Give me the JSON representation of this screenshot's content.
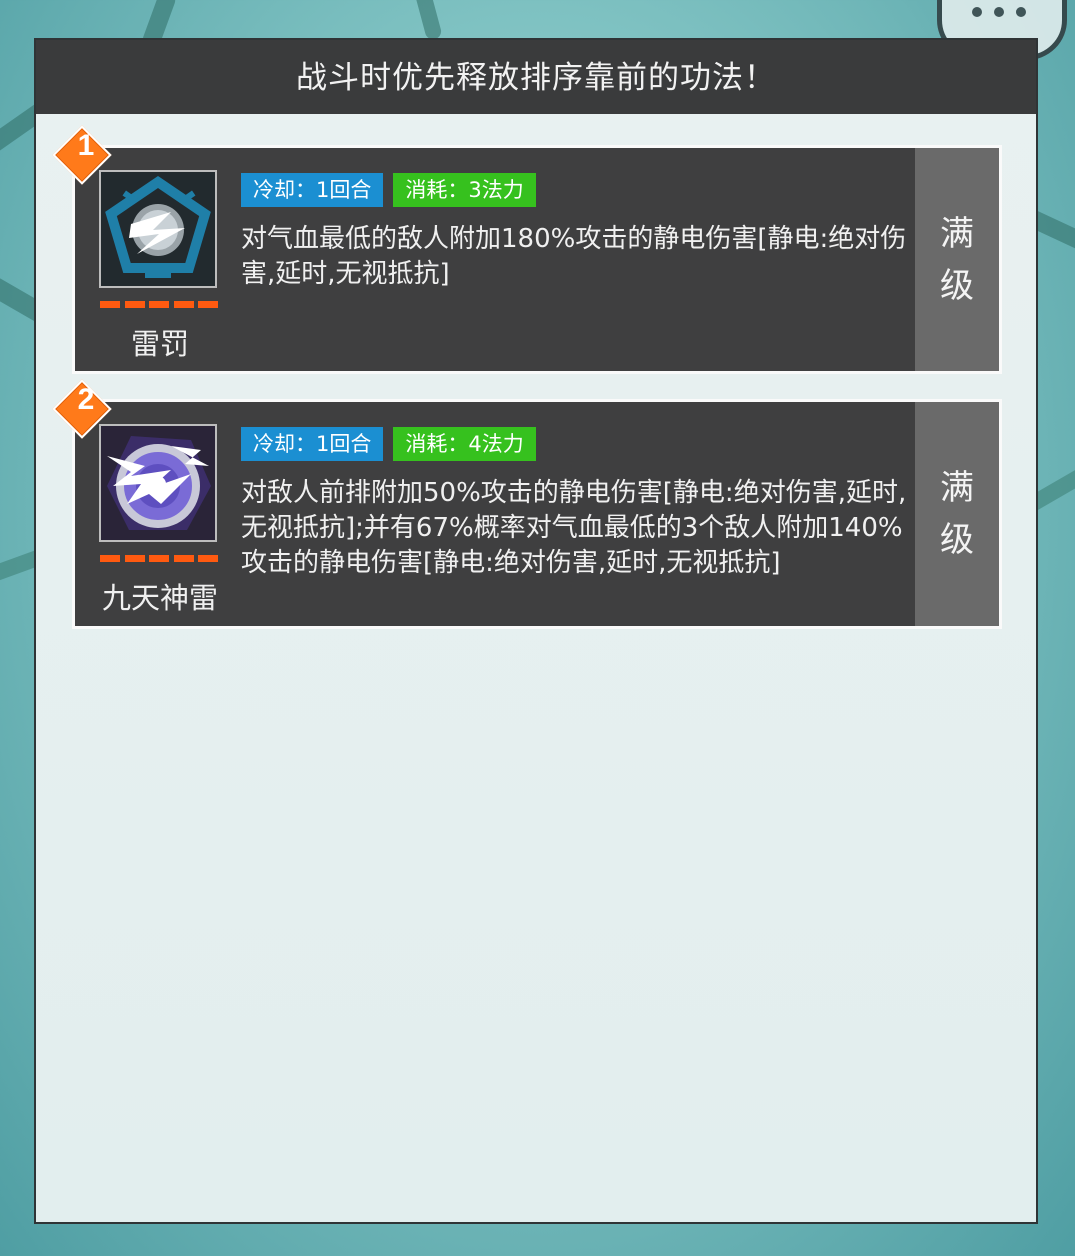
{
  "header": {
    "title": "战斗时优先释放排序靠前的功法！"
  },
  "skills": [
    {
      "rank": "1",
      "name": "雷罚",
      "icon": "lightning-pentagon-icon",
      "cooldown": "冷却：1回合",
      "cost": "消耗：3法力",
      "description": "对气血最低的敌人附加180%攻击的静电伤害[静电:绝对伤害,延时,无视抵抗]",
      "level_top": "满",
      "level_bottom": "级"
    },
    {
      "rank": "2",
      "name": "九天神雷",
      "icon": "purple-lightning-orb-icon",
      "cooldown": "冷却：1回合",
      "cost": "消耗：4法力",
      "description": "对敌人前排附加50%攻击的静电伤害[静电:绝对伤害,延时,无视抵抗];并有67%概率对气血最低的3个敌人附加140%攻击的静电伤害[静电:绝对伤害,延时,无视抵抗]",
      "level_top": "满",
      "level_bottom": "级"
    }
  ],
  "colors": {
    "header_bg": "#3a3b3c",
    "card_bg": "#3f3f40",
    "cooldown_tag": "#1b8fd2",
    "cost_tag": "#36c11e",
    "rank_badge": "#ff7a1a",
    "star_bar": "#ff5a10"
  }
}
